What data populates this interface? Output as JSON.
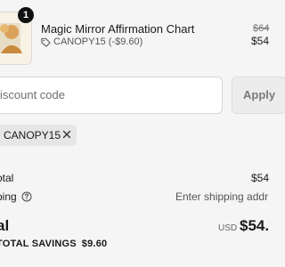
{
  "product": {
    "quantity": "1",
    "title": "Magic Mirror Affirmation Chart",
    "discount": "CANOPY15 (-$9.60)",
    "original_price": "$64",
    "sale_price": "$54",
    "thumbnail_icon": "product-image-icon"
  },
  "discount_form": {
    "placeholder": "iscount code",
    "apply_label": "Apply"
  },
  "applied_code": {
    "code": "CANOPY15",
    "remove_icon": "close-icon"
  },
  "totals": {
    "subtotal_label": "otal",
    "subtotal_value": "$54",
    "shipping_label": "ping",
    "shipping_value": "Enter shipping addr",
    "total_label": "al",
    "currency": "USD",
    "total_value": "$54.",
    "savings_label": "TOTAL SAVINGS",
    "savings_value": "$9.60"
  },
  "colors": {
    "background": "#f5f5f5",
    "badge": "#111111",
    "chip": "#e6e6e6",
    "button": "#ececec"
  }
}
